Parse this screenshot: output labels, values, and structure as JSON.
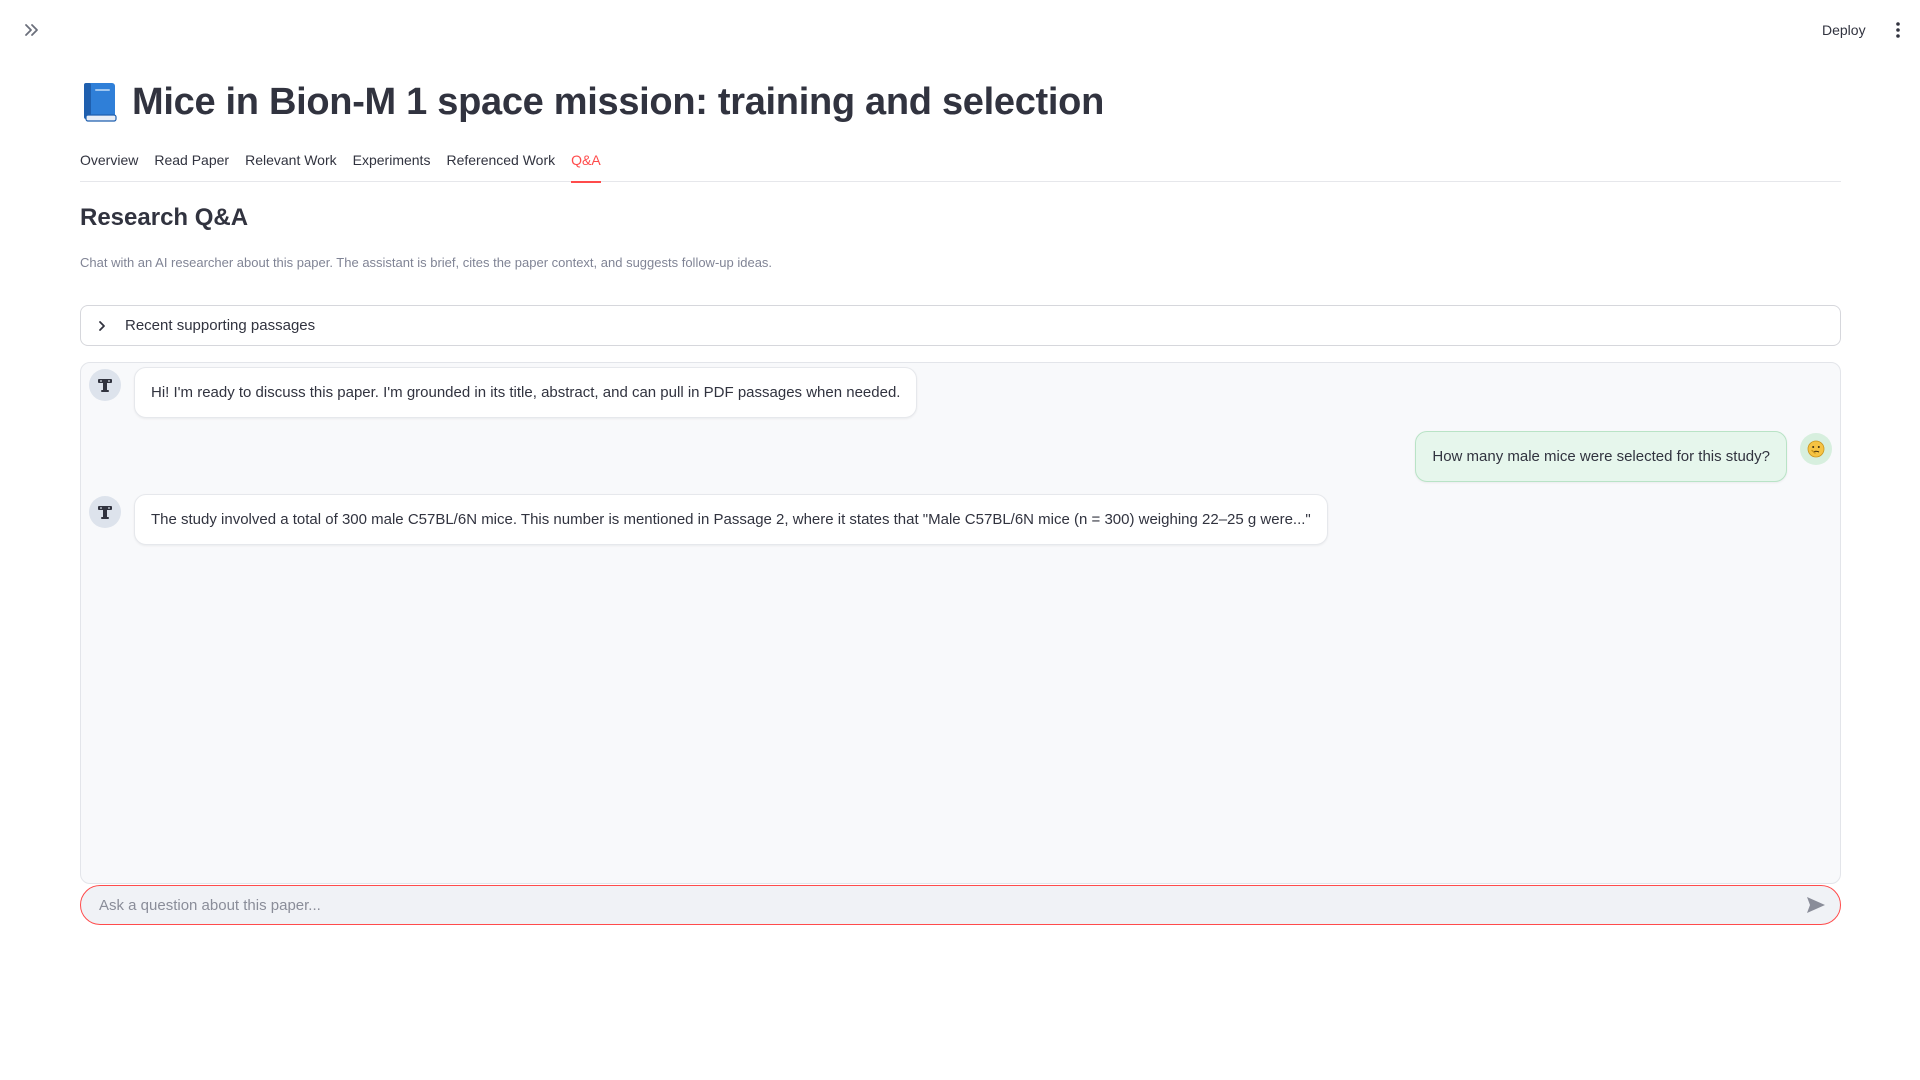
{
  "header": {
    "deploy_label": "Deploy"
  },
  "page": {
    "title": "Mice in Bion-M 1 space mission: training and selection",
    "title_icon": "blue-book-icon"
  },
  "tabs": [
    {
      "label": "Overview",
      "active": false
    },
    {
      "label": "Read Paper",
      "active": false
    },
    {
      "label": "Relevant Work",
      "active": false
    },
    {
      "label": "Experiments",
      "active": false
    },
    {
      "label": "Referenced Work",
      "active": false
    },
    {
      "label": "Q&A",
      "active": true
    }
  ],
  "qa": {
    "heading": "Research Q&A",
    "caption": "Chat with an AI researcher about this paper. The assistant is brief, cites the paper context, and suggests follow-up ideas.",
    "expander_label": "Recent supporting passages"
  },
  "messages": [
    {
      "role": "assistant",
      "avatar": "robot-icon",
      "text": "Hi! I'm ready to discuss this paper. I'm grounded in its title, abstract, and can pull in PDF passages when needed."
    },
    {
      "role": "user",
      "avatar": "thinking-face-icon",
      "text": "How many male mice were selected for this study?"
    },
    {
      "role": "assistant",
      "avatar": "robot-icon",
      "text": "The study involved a total of 300 male C57BL/6N mice. This number is mentioned in Passage 2, where it states that \"Male C57BL/6N mice (n = 300) weighing 22–25 g were...\""
    }
  ],
  "input": {
    "placeholder": "Ask a question about this paper..."
  },
  "colors": {
    "accent": "#ff4b4b",
    "user_bubble": "#e6f6ec",
    "assistant_bubble": "#ffffff"
  }
}
